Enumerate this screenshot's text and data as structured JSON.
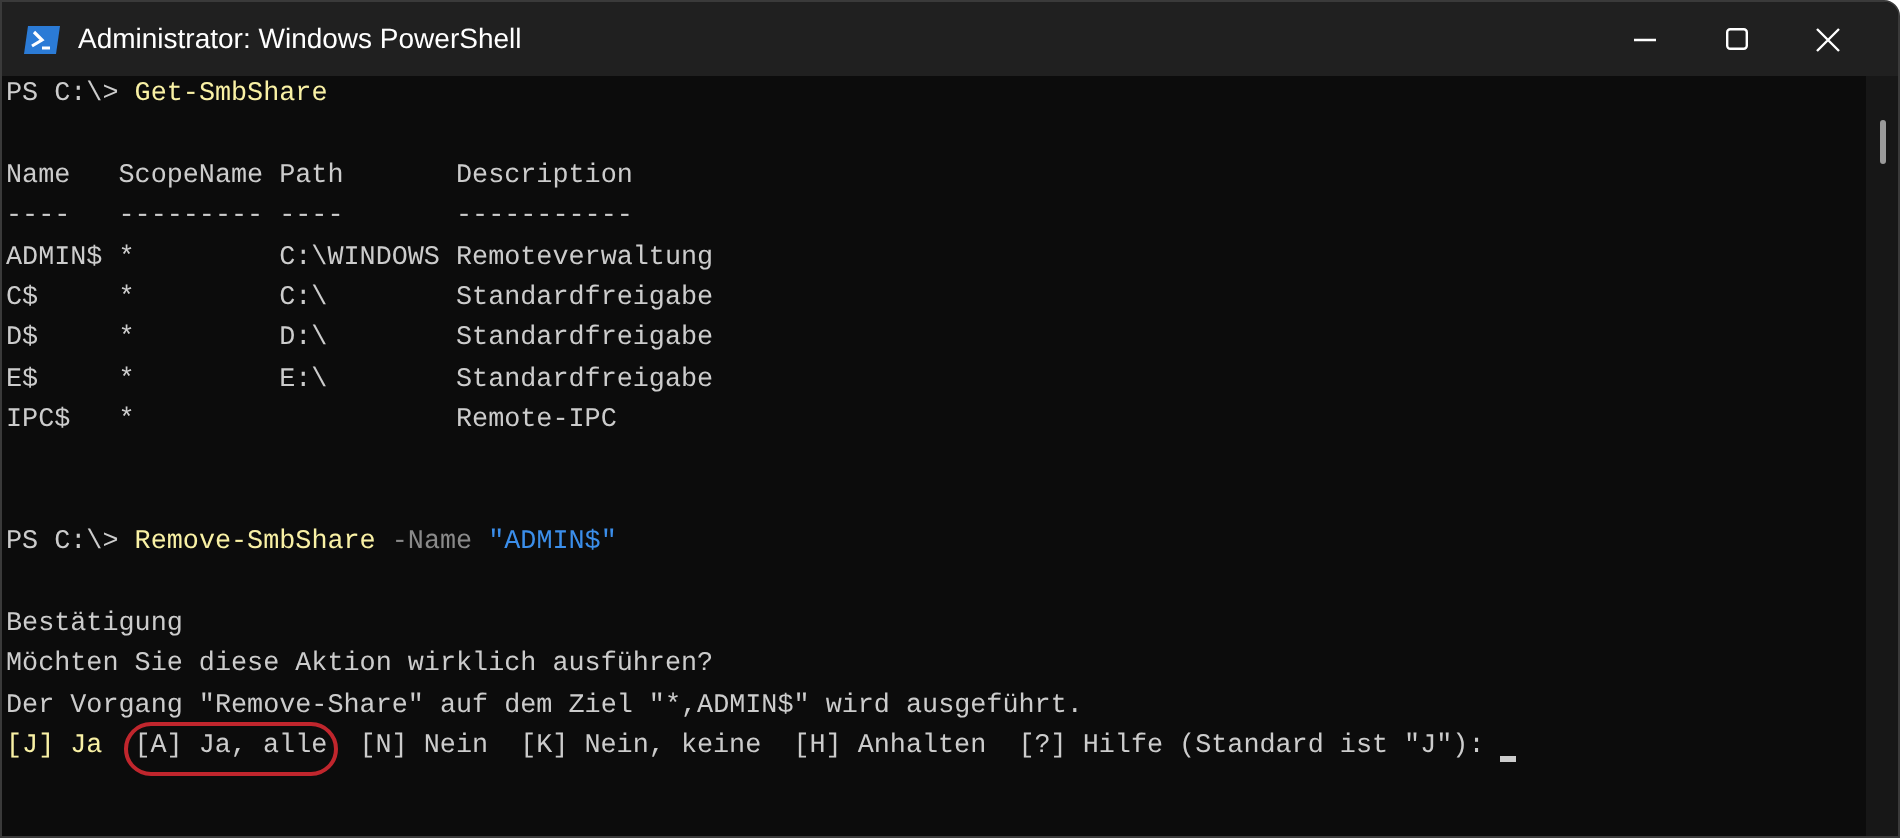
{
  "window": {
    "title": "Administrator: Windows PowerShell"
  },
  "lines": [
    {
      "kind": "text",
      "segments": [
        {
          "text": "PS C:\\> ",
          "kind": "prompt"
        },
        {
          "text": "Get-SmbShare",
          "kind": "command"
        }
      ]
    },
    {
      "kind": "blank"
    },
    {
      "kind": "text",
      "segments": [
        {
          "text": "Name   ScopeName Path       Description",
          "kind": "output"
        }
      ]
    },
    {
      "kind": "text",
      "segments": [
        {
          "text": "----   --------- ----       -----------",
          "kind": "output"
        }
      ]
    },
    {
      "kind": "text",
      "segments": [
        {
          "text": "ADMIN$ *         C:\\WINDOWS Remoteverwaltung",
          "kind": "output"
        }
      ]
    },
    {
      "kind": "text",
      "segments": [
        {
          "text": "C$     *         C:\\        Standardfreigabe",
          "kind": "output"
        }
      ]
    },
    {
      "kind": "text",
      "segments": [
        {
          "text": "D$     *         D:\\        Standardfreigabe",
          "kind": "output"
        }
      ]
    },
    {
      "kind": "text",
      "segments": [
        {
          "text": "E$     *         E:\\        Standardfreigabe",
          "kind": "output"
        }
      ]
    },
    {
      "kind": "text",
      "segments": [
        {
          "text": "IPC$   *                    Remote-IPC",
          "kind": "output"
        }
      ]
    },
    {
      "kind": "blank"
    },
    {
      "kind": "blank"
    },
    {
      "kind": "text",
      "segments": [
        {
          "text": "PS C:\\> ",
          "kind": "prompt"
        },
        {
          "text": "Remove-SmbShare",
          "kind": "command"
        },
        {
          "text": " -Name",
          "kind": "parameter"
        },
        {
          "text": " \"ADMIN$\"",
          "kind": "string"
        }
      ]
    },
    {
      "kind": "blank"
    },
    {
      "kind": "text",
      "segments": [
        {
          "text": "Bestätigung",
          "kind": "output"
        }
      ]
    },
    {
      "kind": "text",
      "segments": [
        {
          "text": "Möchten Sie diese Aktion wirklich ausführen?",
          "kind": "output"
        }
      ]
    },
    {
      "kind": "text",
      "segments": [
        {
          "text": "Der Vorgang \"Remove-Share\" auf dem Ziel \"*,ADMIN$\" wird ausgeführt.",
          "kind": "output"
        }
      ]
    },
    {
      "kind": "text",
      "cursor": true,
      "segments": [
        {
          "text": "[J] Ja",
          "kind": "default-choice"
        },
        {
          "text": "[A] Ja, alle",
          "kind": "output",
          "circled": true
        },
        {
          "text": "  [N] Nein  [K] Nein, keine  [H] Anhalten  [?] Hilfe (Standard ist \"J\"): ",
          "kind": "output"
        }
      ]
    }
  ]
}
